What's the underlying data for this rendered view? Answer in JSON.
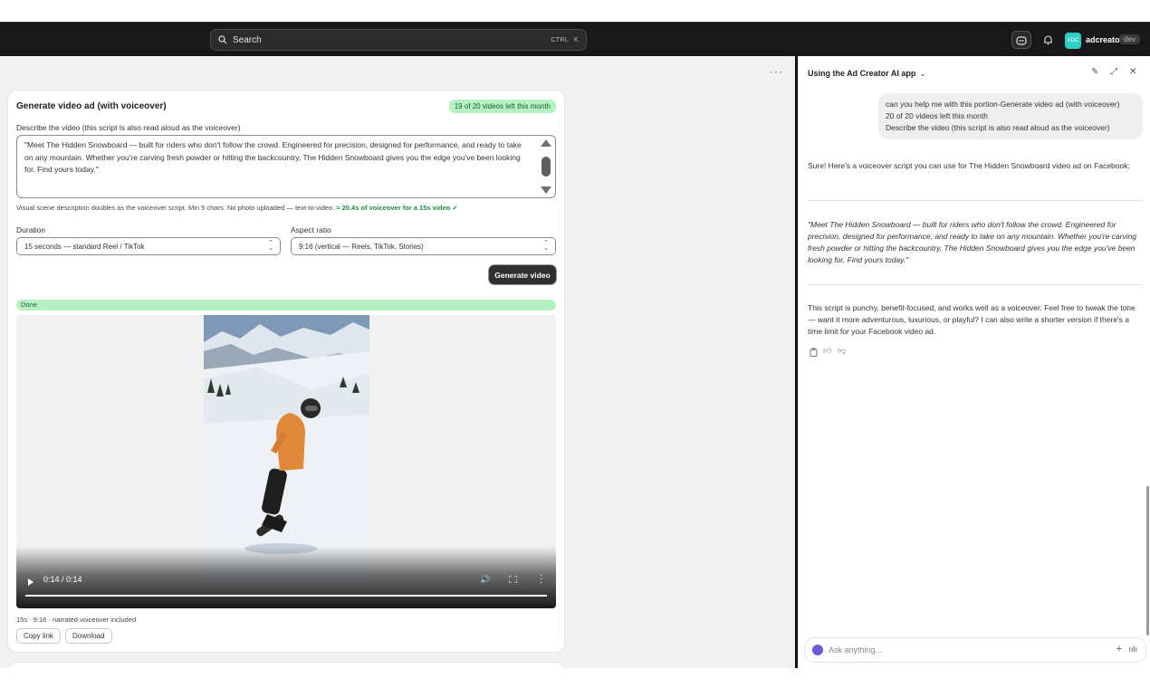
{
  "topbar": {
    "search_label": "Search",
    "search_kbd_ctrl": "CTRL",
    "search_kbd_key": "K",
    "store_name": "adcreator",
    "store_avatar_text": "ADC",
    "env_badge": "dev"
  },
  "card": {
    "title": "Generate video ad (with voiceover)",
    "quota_badge": "19 of 20 videos left this month",
    "describe_label": "Describe the video (this script is also read aloud as the voiceover)",
    "script_text": "\"Meet The Hidden Snowboard — built for riders who don't follow the crowd. Engineered for precision, designed for performance, and ready to take on any mountain. Whether you're carving fresh powder or hitting the backcountry, The Hidden Snowboard gives you the edge you've been looking for. Find yours today.\"",
    "hint_text": "Visual scene description doubles as the voiceover script. Min 5 chars. No photo uploaded — text-to-video. ",
    "hint_highlight": "≈ 20.4s of voiceover for a 15s video ✓",
    "duration_label": "Duration",
    "duration_value": "15 seconds — standard Reel / TikTok",
    "aspect_label": "Aspect ratio",
    "aspect_value": "9:16 (vertical — Reels, TikTok, Stories)",
    "generate_button": "Generate video",
    "status": "Done",
    "video_time": "0:14 / 0:14",
    "video_progress": 1.0,
    "video_meta": "15s · 9:16 · narrated voiceover included",
    "copy_link_button": "Copy link",
    "download_button": "Download"
  },
  "chat": {
    "title": "Using the Ad Creator AI app",
    "user_message_lines": [
      "can you help me with this portion-Generate video ad (with voiceover)",
      "20 of 20 videos left this month",
      "Describe the video (this script is also read aloud as the voiceover)"
    ],
    "intro": "Sure! Here's a voiceover script you can use for The Hidden Snowboard video ad on Facebook:",
    "script": "\"Meet The Hidden Snowboard — built for riders who don't follow the crowd. Engineered for precision, designed for performance, and ready to take on any mountain. Whether you're carving fresh powder or hitting the backcountry, The Hidden Snowboard gives you the edge you've been looking for. Find yours today.\"",
    "outro": "This script is punchy, benefit-focused, and works well as a voiceover. Feel free to tweak the tone — want it more adventurous, luxurious, or playful? I can also write a shorter version if there's a time limit for your Facebook video ad.",
    "composer_placeholder": "Ask anything..."
  },
  "icons": {
    "search": "search-icon",
    "sidekick": "sidekick-icon",
    "bell": "bell-icon",
    "chevron": "chevron-down-icon",
    "edit": "edit-icon",
    "expand": "expand-icon",
    "close": "close-icon",
    "copy": "copy-icon",
    "thumbs_up": "thumbs-up-icon",
    "thumbs_down": "thumbs-down-icon",
    "plus": "plus-icon",
    "voice": "voice-icon"
  }
}
